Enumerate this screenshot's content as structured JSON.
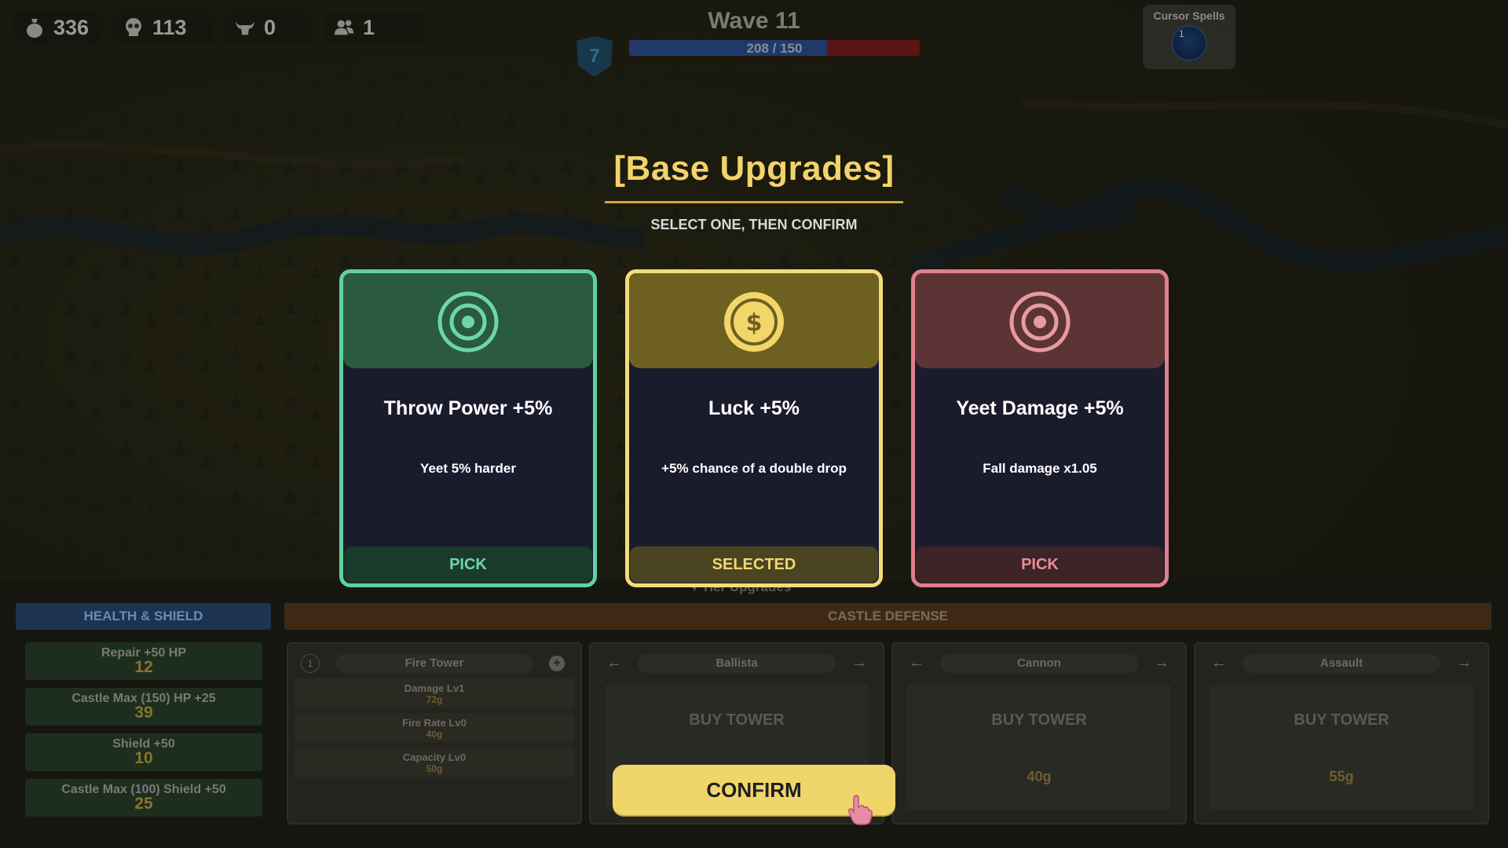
{
  "hud": {
    "gold": "336",
    "kills": "113",
    "bosses": "0",
    "population": "1",
    "wave_title": "Wave 11",
    "level": "7",
    "hp_text": "208 / 150",
    "hp_fraction": 0.68,
    "spells_label": "Cursor Spells",
    "spell_slot_number": "1"
  },
  "modal": {
    "title": "[Base Upgrades]",
    "subtitle": "SELECT ONE, THEN CONFIRM",
    "cards": [
      {
        "name": "Throw Power +5%",
        "desc": "Yeet 5% harder",
        "button": "PICK",
        "icon": "target-icon",
        "accent": "#5fd1a4"
      },
      {
        "name": "Luck +5%",
        "desc": "+5% chance of a double drop",
        "button": "SELECTED",
        "icon": "coin-icon",
        "accent": "#f3dd7a"
      },
      {
        "name": "Yeet Damage +5%",
        "desc": "Fall damage x1.05",
        "button": "PICK",
        "icon": "target-icon",
        "accent": "#e0808a"
      }
    ],
    "confirm_label": "CONFIRM"
  },
  "bottom": {
    "tier_label": "Tier Upgrades",
    "health_shield": {
      "header": "HEALTH & SHIELD",
      "items": [
        {
          "label": "Repair +50 HP",
          "cost": "12"
        },
        {
          "label": "Castle Max (150) HP +25",
          "cost": "39"
        },
        {
          "label": "Shield +50",
          "cost": "10"
        },
        {
          "label": "Castle Max (100) Shield +50",
          "cost": "25"
        }
      ]
    },
    "castle_defense": {
      "header": "CASTLE DEFENSE",
      "fire_tower": {
        "name": "Fire Tower",
        "badge": "1",
        "stats": [
          {
            "label": "Damage Lv1",
            "cost": "72g"
          },
          {
            "label": "Fire Rate Lv0",
            "cost": "40g"
          },
          {
            "label": "Capacity Lv0",
            "cost": "50g"
          }
        ]
      },
      "towers": [
        {
          "name": "Ballista",
          "buy": "BUY TOWER",
          "cost": ""
        },
        {
          "name": "Cannon",
          "buy": "BUY TOWER",
          "cost": "40g"
        },
        {
          "name": "Assault",
          "buy": "BUY TOWER",
          "cost": "55g"
        }
      ]
    }
  },
  "colors": {
    "title_gold": "#f2d26a",
    "confirm_bg": "#f0d56a",
    "green_accent": "#5fd1a4",
    "gold_accent": "#f3dd7a",
    "red_accent": "#e0808a"
  }
}
